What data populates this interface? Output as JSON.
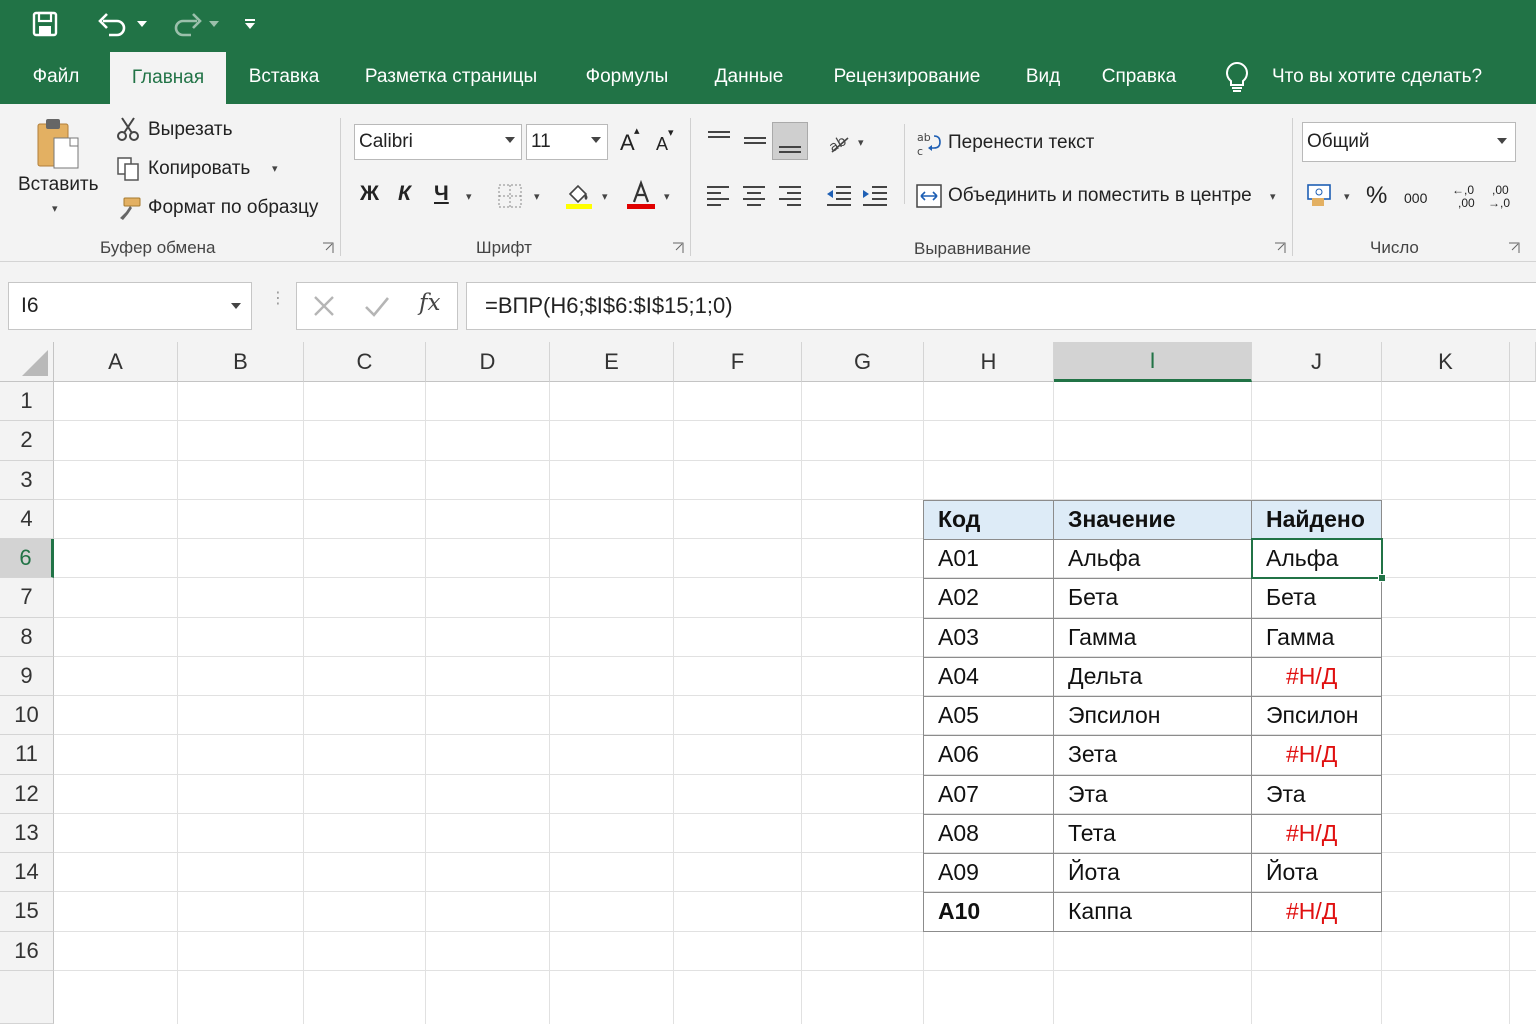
{
  "tabs": [
    {
      "label": "Файл",
      "active": false
    },
    {
      "label": "Главная",
      "active": true
    },
    {
      "label": "Вставка",
      "active": false
    },
    {
      "label": "Разметка страницы",
      "active": false
    },
    {
      "label": "Формулы",
      "active": false
    },
    {
      "label": "Данные",
      "active": false
    },
    {
      "label": "Рецензирование",
      "active": false
    },
    {
      "label": "Вид",
      "active": false
    },
    {
      "label": "Справка",
      "active": false
    }
  ],
  "tell_me": "Что вы хотите сделать?",
  "clipboard": {
    "paste": "Вставить",
    "cut": "Вырезать",
    "copy": "Копировать",
    "format_painter": "Формат по образцу",
    "group": "Буфер обмена"
  },
  "font": {
    "name": "Calibri",
    "size": "11",
    "bold": "Ж",
    "italic": "К",
    "underline": "Ч",
    "grow": "A",
    "shrink": "A",
    "font_color": "A",
    "group": "Шрифт"
  },
  "alignment": {
    "wrap_text": "Перенести текст",
    "merge_center": "Объединить и поместить в центре",
    "group": "Выравнивание"
  },
  "number": {
    "format": "Общий",
    "percent": "%",
    "thousands": "000",
    "inc_decimal_top": "←,0",
    "inc_decimal_bottom": ",00",
    "dec_decimal_top": ",00",
    "dec_decimal_bottom": "→,0",
    "group": "Число"
  },
  "formula_bar": {
    "name_box": "I6",
    "fx": "fx",
    "formula": "=ВПР(H6;$I$6:$I$15;1;0)"
  },
  "columns": [
    "A",
    "B",
    "C",
    "D",
    "E",
    "F",
    "G",
    "H",
    "I",
    "J",
    "K"
  ],
  "selected_column": "I",
  "rows": [
    "1",
    "2",
    "3",
    "4",
    "6",
    "7",
    "8",
    "9",
    "10",
    "11",
    "12",
    "13",
    "14",
    "15",
    "16"
  ],
  "selected_row": "6",
  "table": {
    "headers": [
      "Код",
      "Значение",
      "Найдено"
    ],
    "rows": [
      {
        "code": "A01",
        "value": "Альфа",
        "found": "Альфа",
        "error": false
      },
      {
        "code": "A02",
        "value": "Бета",
        "found": "Бета",
        "error": false
      },
      {
        "code": "A03",
        "value": "Гамма",
        "found": "Гамма",
        "error": false
      },
      {
        "code": "A04",
        "value": "Дельта",
        "found": "#Н/Д",
        "error": true
      },
      {
        "code": "A05",
        "value": "Эпсилон",
        "found": "Эпсилон",
        "error": false
      },
      {
        "code": "A06",
        "value": "Зета",
        "found": "#Н/Д",
        "error": true
      },
      {
        "code": "A07",
        "value": "Эта",
        "found": "Эта",
        "error": false
      },
      {
        "code": "A08",
        "value": "Тета",
        "found": "#Н/Д",
        "error": true
      },
      {
        "code": "A09",
        "value": "Йота",
        "found": "Йота",
        "error": false
      },
      {
        "code": "A10",
        "value": "Каппа",
        "found": "#Н/Д",
        "error": true
      }
    ]
  },
  "colors": {
    "brand_green": "#217346",
    "header_fill": "#ddebf7",
    "error_red": "#e01010",
    "highlight_yellow": "#ffff00",
    "font_red": "#e00000"
  }
}
